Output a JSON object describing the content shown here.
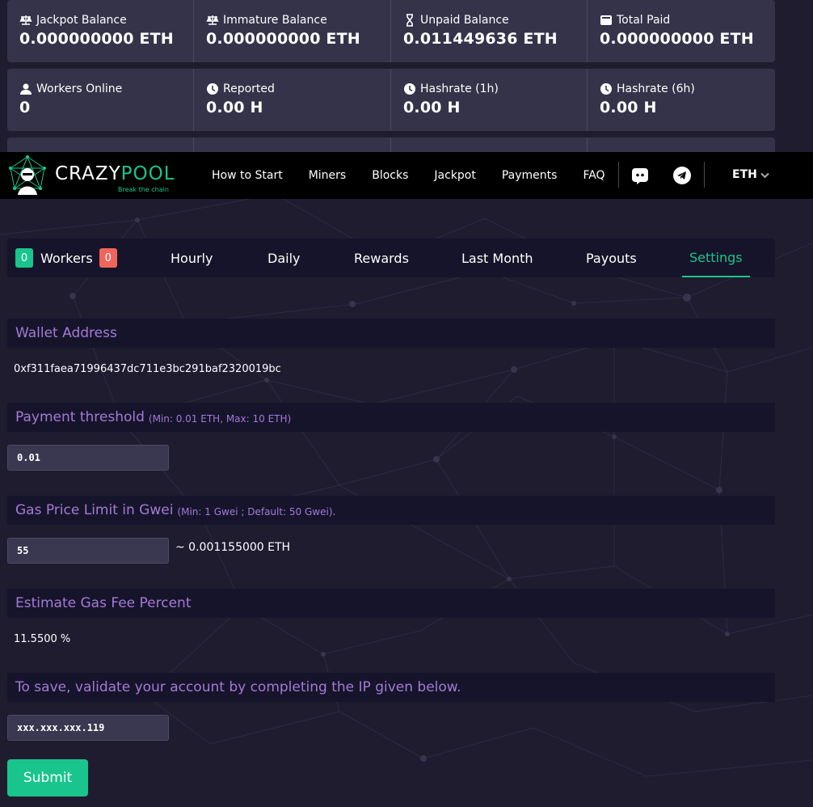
{
  "stats": {
    "row1": [
      {
        "label": "Jackpot Balance",
        "value": "0.000000000 ETH",
        "icon": "balance-scale-icon"
      },
      {
        "label": "Immature Balance",
        "value": "0.000000000 ETH",
        "icon": "balance-scale-icon"
      },
      {
        "label": "Unpaid Balance",
        "value": "0.011449636 ETH",
        "icon": "hourglass-icon"
      },
      {
        "label": "Total Paid",
        "value": "0.000000000 ETH",
        "icon": "wallet-icon"
      }
    ],
    "row2": [
      {
        "label": "Workers Online",
        "value": "0",
        "icon": "users-icon"
      },
      {
        "label": "Reported",
        "value": "0.00 H",
        "icon": "clock-icon"
      },
      {
        "label": "Hashrate (1h)",
        "value": "0.00 H",
        "icon": "clock-icon"
      },
      {
        "label": "Hashrate (6h)",
        "value": "0.00 H",
        "icon": "clock-icon"
      }
    ]
  },
  "navbar": {
    "logo_word_1": "CRAZY",
    "logo_word_2": "POOL",
    "logo_tagline": "Break the chain",
    "links": [
      "How to Start",
      "Miners",
      "Blocks",
      "Jackpot",
      "Payments",
      "FAQ"
    ],
    "coin": "ETH"
  },
  "tabs": {
    "workers_online_count": "0",
    "workers_label": "Workers",
    "workers_offline_count": "0",
    "items": [
      "Hourly",
      "Daily",
      "Rewards",
      "Last Month",
      "Payouts",
      "Settings"
    ],
    "active": "Settings"
  },
  "settings": {
    "wallet_title": "Wallet Address",
    "wallet_address": "0xf311faea71996437dc711e3bc291baf2320019bc",
    "threshold_title": "Payment threshold",
    "threshold_hint": "(Min: 0.01 ETH, Max: 10 ETH)",
    "threshold_value": "0.01",
    "gas_title": "Gas Price Limit in Gwei",
    "gas_hint": "(Min: 1 Gwei ; Default: 50 Gwei).",
    "gas_value": "55",
    "gas_eth": "~ 0.001155000 ETH",
    "fee_title": "Estimate Gas Fee Percent",
    "fee_value": "11.5500 %",
    "validate_title": "To save, validate your account by completing the IP given below.",
    "ip_value": "xxx.xxx.xxx.119",
    "submit_label": "Submit"
  },
  "colors": {
    "accent": "#19c58c",
    "section_title": "#a37ad6",
    "badge_offline": "#f0655a",
    "panel": "#35334a",
    "background": "#1f1c30"
  }
}
